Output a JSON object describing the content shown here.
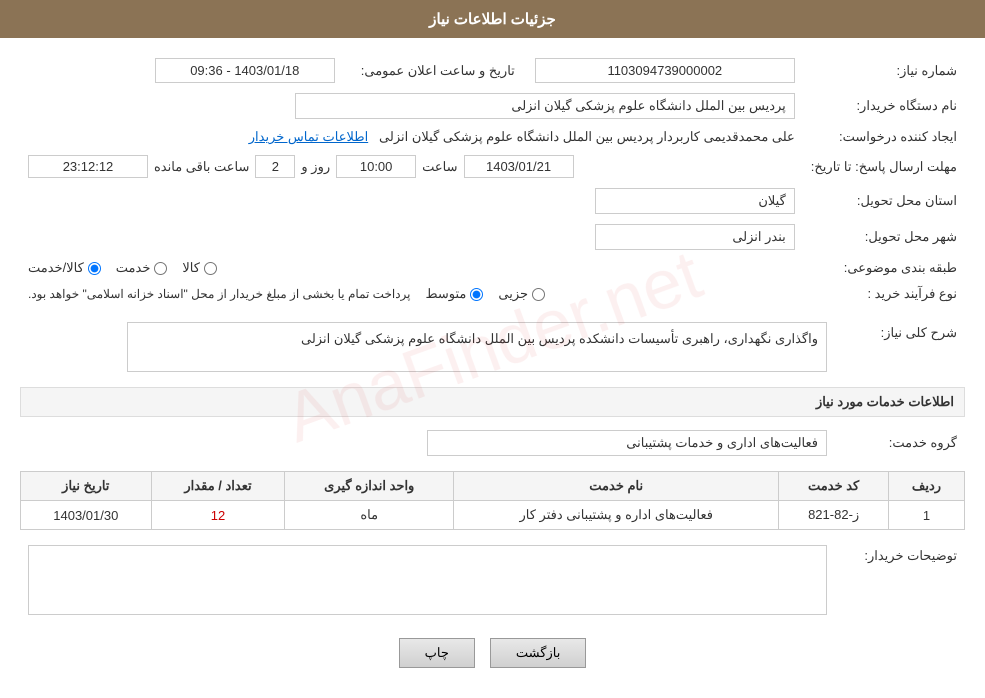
{
  "page": {
    "title": "جزئیات اطلاعات نیاز",
    "header_bg": "#8B7355"
  },
  "fields": {
    "request_number_label": "شماره نیاز:",
    "request_number_value": "1103094739000002",
    "org_name_label": "نام دستگاه خریدار:",
    "org_name_value": "پردیس بین الملل دانشگاه علوم پزشکی گیلان انزلی",
    "creator_label": "ایجاد کننده درخواست:",
    "creator_value": "علی  محمدقدیمی کاربردار پردیس بین الملل دانشگاه علوم پزشکی گیلان انزلی",
    "creator_link": "اطلاعات تماس خریدار",
    "announce_date_label": "تاریخ و ساعت اعلان عمومی:",
    "announce_date_value": "1403/01/18 - 09:36",
    "reply_deadline_label": "مهلت ارسال پاسخ: تا تاریخ:",
    "reply_date_value": "1403/01/21",
    "reply_time_label": "ساعت",
    "reply_time_value": "10:00",
    "reply_day_label": "روز و",
    "reply_day_value": "2",
    "reply_remaining_label": "ساعت باقی مانده",
    "reply_remaining_value": "23:12:12",
    "province_label": "استان محل تحویل:",
    "province_value": "گیلان",
    "city_label": "شهر محل تحویل:",
    "city_value": "بندر انزلی",
    "subject_label": "طبقه بندی موضوعی:",
    "subject_kala": "کالا",
    "subject_khadamat": "خدمت",
    "subject_kala_khadamat": "کالا/خدمت",
    "subject_selected": "kala_khadamat",
    "purchase_type_label": "نوع فرآیند خرید :",
    "purchase_jozi": "جزیی",
    "purchase_motavasset": "متوسط",
    "purchase_selected": "motavasset",
    "purchase_desc": "پرداخت تمام یا بخشی از مبلغ خریدار از محل \"اسناد خزانه اسلامی\" خواهد بود.",
    "general_desc_label": "شرح کلی نیاز:",
    "general_desc_value": "واگذاری نگهداری، راهبری تأسیسات دانشکده پردیس بین الملل دانشگاه علوم پزشکی گیلان انزلی",
    "services_section_label": "اطلاعات خدمات مورد نیاز",
    "service_group_label": "گروه خدمت:",
    "service_group_value": "فعالیت‌های اداری و خدمات پشتیبانی",
    "table_headers": {
      "row_num": "ردیف",
      "service_code": "کد خدمت",
      "service_name": "نام خدمت",
      "unit": "واحد اندازه گیری",
      "quantity": "تعداد / مقدار",
      "date": "تاریخ نیاز"
    },
    "table_rows": [
      {
        "row_num": "1",
        "service_code": "ز-82-821",
        "service_name": "فعالیت‌های اداره و پشتیبانی دفتر کار",
        "unit": "ماه",
        "quantity": "12",
        "date": "1403/01/30"
      }
    ],
    "buyer_desc_label": "توضیحات خریدار:",
    "btn_print": "چاپ",
    "btn_back": "بازگشت"
  }
}
